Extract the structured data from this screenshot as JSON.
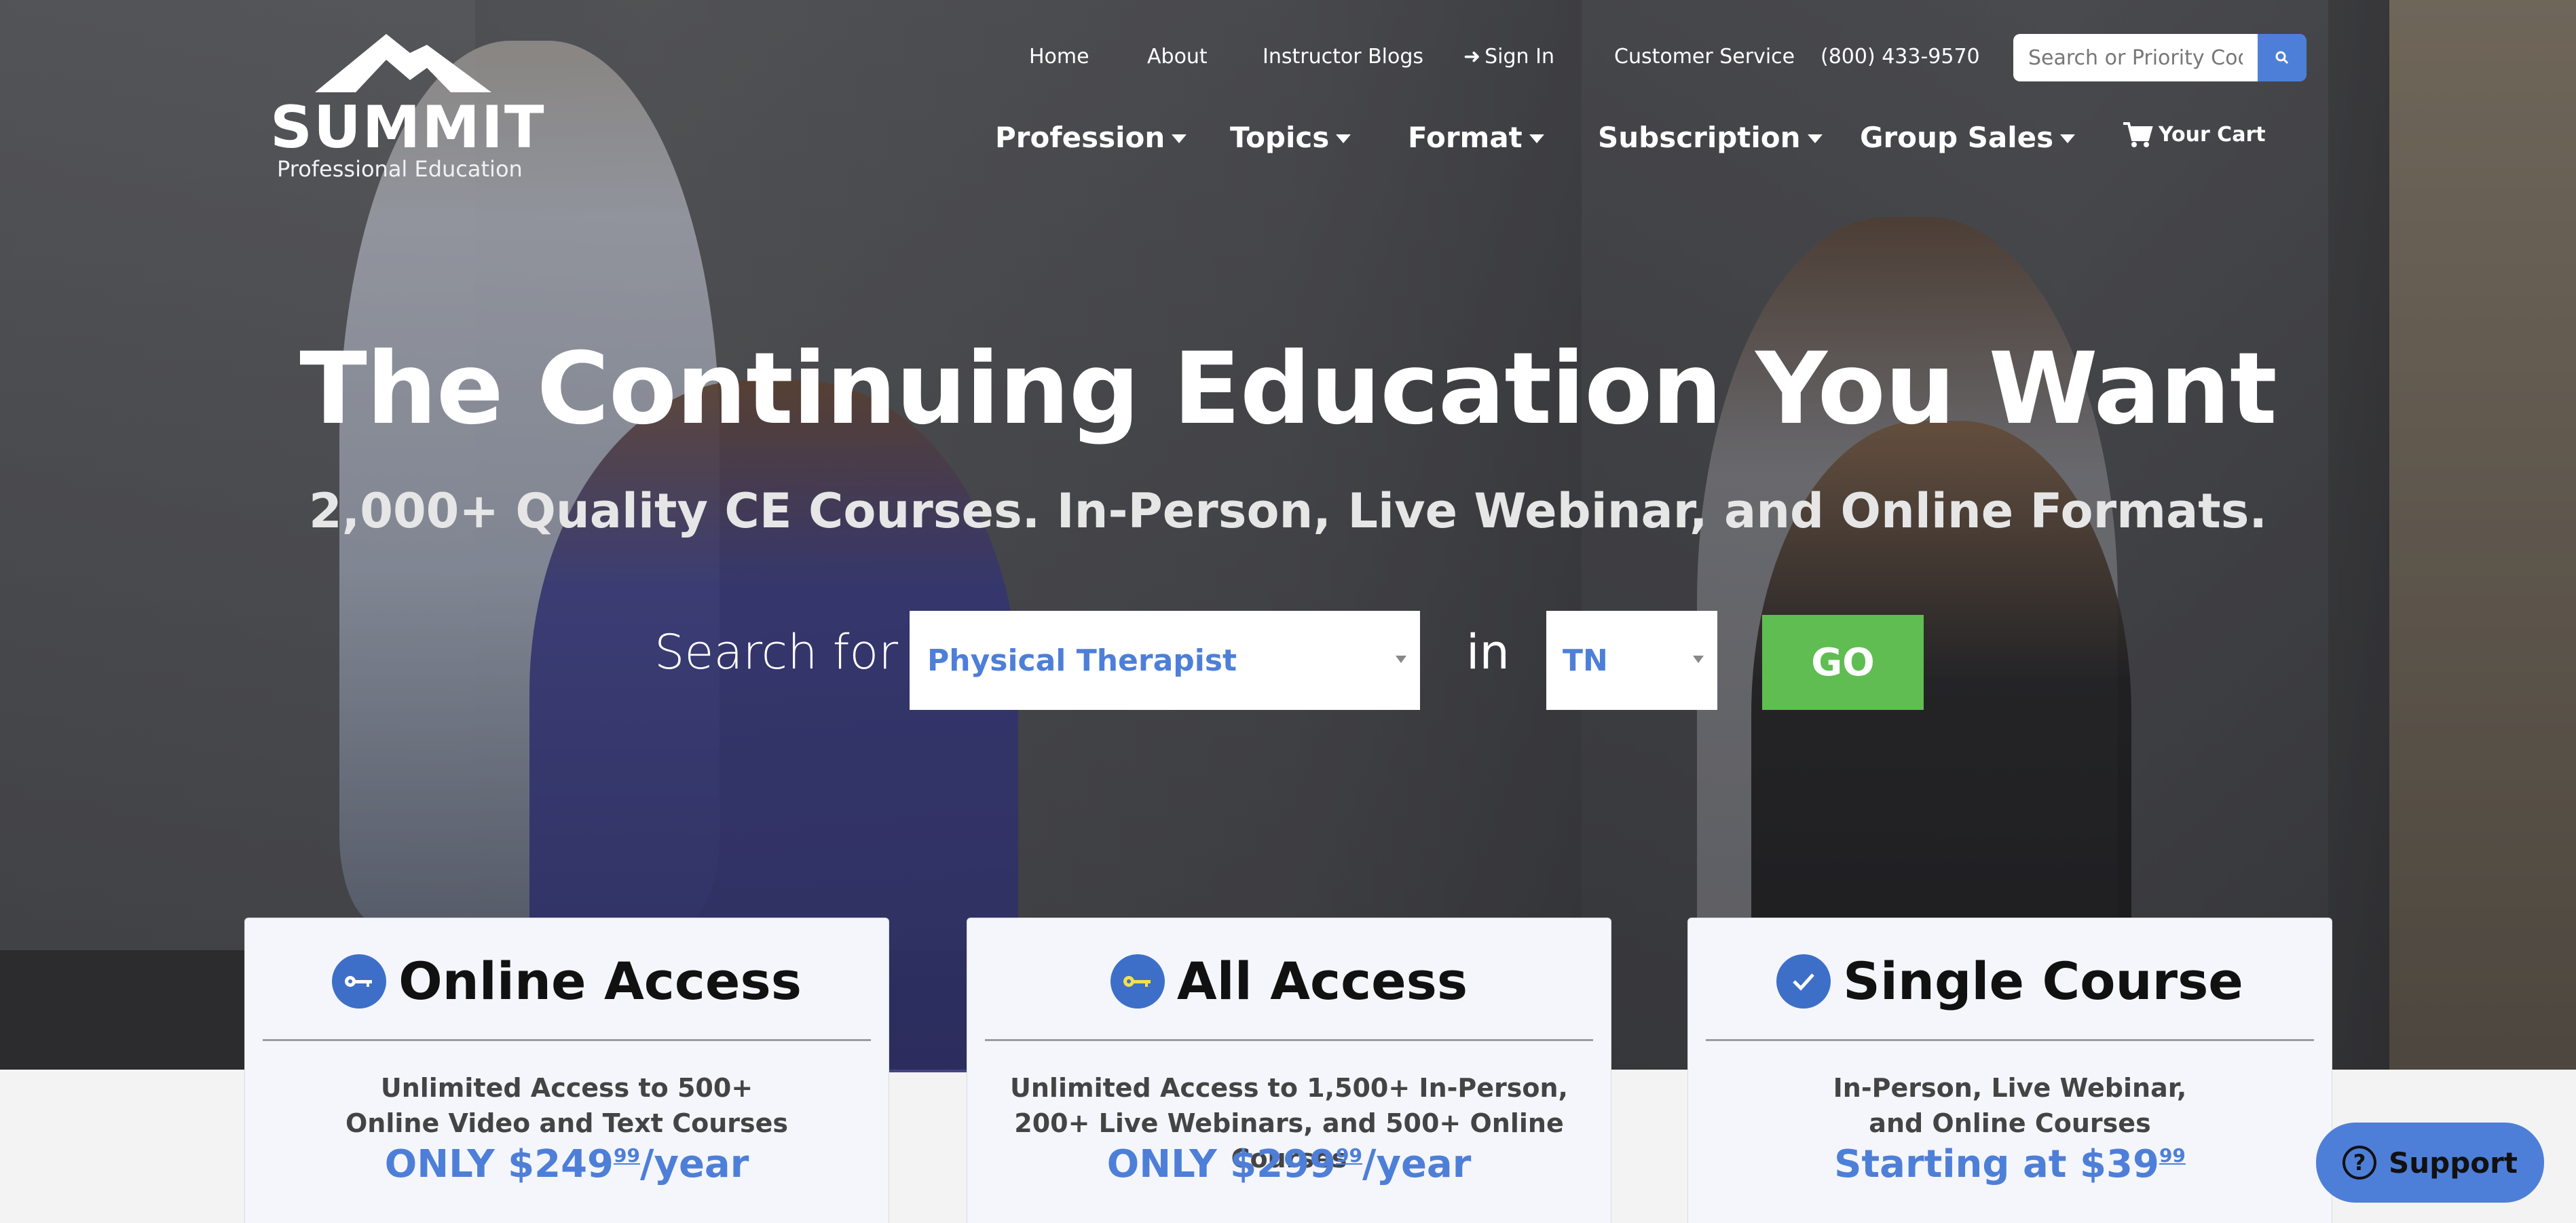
{
  "logo": {
    "brand": "SUMMIT",
    "subtitle": "Professional Education"
  },
  "topnav": {
    "home": "Home",
    "about": "About",
    "instructor_blogs": "Instructor Blogs",
    "sign_in": "Sign In",
    "customer_service": "Customer Service",
    "phone": "(800) 433-9570"
  },
  "search": {
    "placeholder": "Search or Priority Code"
  },
  "mainnav": {
    "profession": "Profession",
    "topics": "Topics",
    "format": "Format",
    "subscription": "Subscription",
    "group_sales": "Group Sales",
    "cart": "Your Cart"
  },
  "hero": {
    "headline": "The Continuing Education You Want",
    "subheadline": "2,000+ Quality CE Courses. In-Person, Live Webinar, and Online Formats.",
    "search_for_label": "Search for",
    "profession_value": "Physical Therapist",
    "in_label": "in",
    "state_value": "TN",
    "go_label": "GO"
  },
  "cards": [
    {
      "title": "Online Access",
      "icon": "key-icon",
      "line1": "Unlimited Access to 500+",
      "line2": "Online Video and Text Courses",
      "price_prefix": "ONLY $249",
      "price_cents": "99",
      "price_suffix": "/year"
    },
    {
      "title": "All Access",
      "icon": "key-icon",
      "line1": "Unlimited Access to 1,500+ In-Person,",
      "line2": "200+ Live Webinars, and 500+ Online Courses",
      "price_prefix": "ONLY $299",
      "price_cents": "99",
      "price_suffix": "/year"
    },
    {
      "title": "Single Course",
      "icon": "check-icon",
      "line1": "In-Person, Live Webinar,",
      "line2": "and Online Courses",
      "price_prefix": "Starting at $39",
      "price_cents": "99",
      "price_suffix": ""
    }
  ],
  "support": {
    "label": "Support"
  },
  "colors": {
    "accent": "#4e7fd8",
    "go": "#5fbd52",
    "card_bg": "#f4f6fb"
  }
}
